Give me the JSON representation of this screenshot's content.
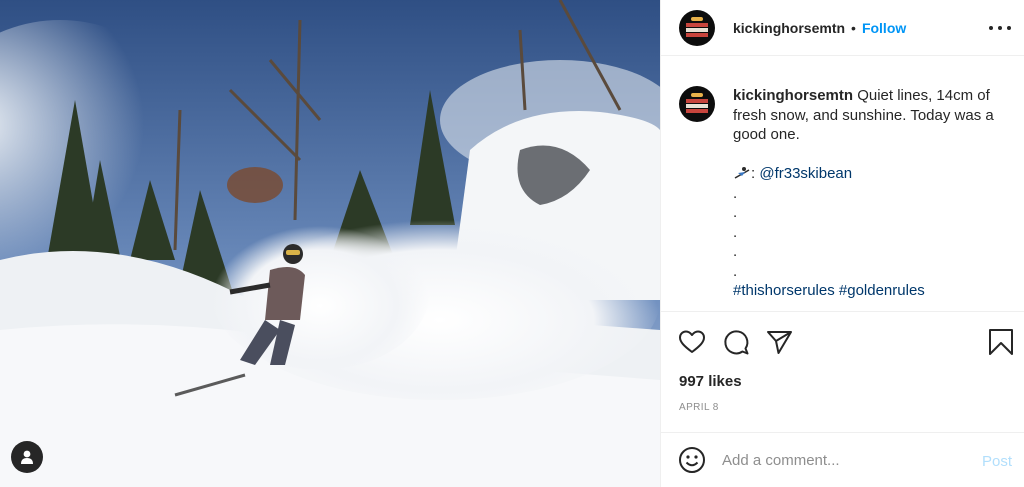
{
  "post": {
    "username": "kickinghorsemtn",
    "separator": "•",
    "follow_label": "Follow",
    "more_icon": "more-horizontal-icon"
  },
  "caption": {
    "username": "kickinghorsemtn",
    "text": "Quiet lines, 14cm of fresh snow, and sunshine. Today was a good one.",
    "credit_emoji": "skier-emoji",
    "credit_sep": ":",
    "credit_handle": "@fr33skibean",
    "dots": [
      ".",
      ".",
      ".",
      ".",
      "."
    ],
    "hashtags": [
      "#thishorserules",
      "#goldenrules"
    ]
  },
  "actions": {
    "like_icon": "heart-icon",
    "comment_icon": "comment-icon",
    "share_icon": "share-icon",
    "save_icon": "bookmark-icon"
  },
  "likes_text": "997 likes",
  "date_text": "APRIL 8",
  "comment_box": {
    "placeholder": "Add a comment...",
    "post_label": "Post"
  },
  "colors": {
    "accent": "#0095f6",
    "link": "#00376b",
    "post_disabled": "#b2dffc",
    "muted": "#8e8e8e"
  }
}
